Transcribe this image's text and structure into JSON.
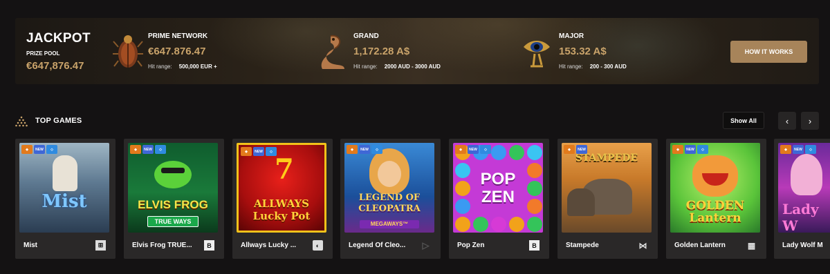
{
  "jackpot": {
    "title": "JACKPOT",
    "subtitle": "PRIZE POOL",
    "amount": "€647,876.47",
    "how_label": "HOW IT WORKS",
    "tiers": [
      {
        "name": "PRIME NETWORK",
        "value": "€647.876.47",
        "hit_label": "Hit range:",
        "hit_range": "500,000 EUR +",
        "icon": "scarab-icon"
      },
      {
        "name": "GRAND",
        "value": "1,172.28 A$",
        "hit_label": "Hit range:",
        "hit_range": "2000 AUD - 3000 AUD",
        "icon": "cobra-icon"
      },
      {
        "name": "MAJOR",
        "value": "153.32 A$",
        "hit_label": "Hit range:",
        "hit_range": "200 - 300 AUD",
        "icon": "eye-of-horus-icon"
      }
    ]
  },
  "top_games": {
    "title": "TOP GAMES",
    "show_all": "Show All",
    "prev_icon": "‹",
    "next_icon": "›",
    "games": [
      {
        "name": "Mist",
        "provider": "⊞",
        "badge_new": "NEW",
        "art": "Mist"
      },
      {
        "name": "Elvis Frog TRUE...",
        "provider": "B",
        "badge_new": "NEW",
        "art": "ELVIS FROG"
      },
      {
        "name": "Allways Lucky ...",
        "provider": "◐",
        "badge_new": "NEW",
        "art": "ALLWAYS Lucky Pot"
      },
      {
        "name": "Legend Of Cleo...",
        "provider": "▷",
        "badge_new": "NEW",
        "art": "LEGEND OF CLEOPATRA"
      },
      {
        "name": "Pop Zen",
        "provider": "B",
        "badge_new": "NEW",
        "art": "POP ZEN"
      },
      {
        "name": "Stampede",
        "provider": "⋈",
        "badge_new": "NEW",
        "art": "STAMPEDE"
      },
      {
        "name": "Golden Lantern",
        "provider": "▦",
        "badge_new": "NEW",
        "art": "GOLDEN Lantern"
      },
      {
        "name": "Lady Wolf M",
        "provider": "",
        "badge_new": "NEW",
        "art": "Lady W"
      }
    ]
  }
}
